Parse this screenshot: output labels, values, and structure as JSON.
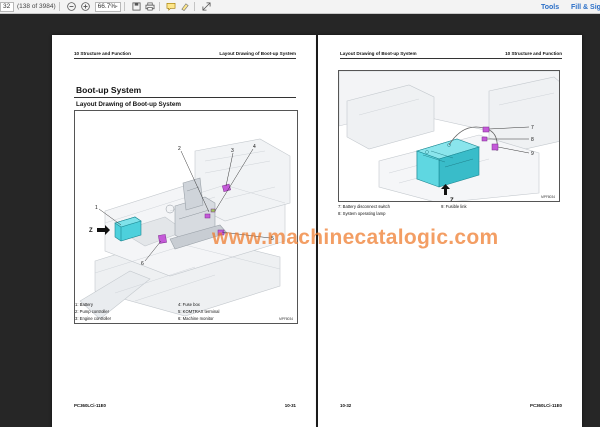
{
  "toolbar": {
    "page_input_value": "32",
    "page_count_text": "(138 of 3984)",
    "zoom_value": "66.7%",
    "tools_label": "Tools",
    "fill_sign_label": "Fill & Sign"
  },
  "page_left": {
    "header_left": "10 Structure and Function",
    "header_right": "Layout Drawing of Boot-up System",
    "section_title": "Boot-up System",
    "subsection_title": "Layout Drawing of Boot-up System",
    "figure_id": "MPF8034",
    "callouts": [
      "1",
      "2",
      "3",
      "4",
      "5",
      "6"
    ],
    "view_label": "Z",
    "legend": [
      "1: Battery",
      "4: Fuse box",
      "2: Pump controller",
      "5: KOMTRAX terminal",
      "3: Engine controller",
      "6: Machine monitor"
    ],
    "footer_left": "PC360LCi-11E0",
    "footer_right": "10-31"
  },
  "page_right": {
    "header_left": "Layout Drawing of Boot-up System",
    "header_right": "10 Structure and Function",
    "figure_id": "MPF8034",
    "callouts": [
      "7",
      "8",
      "9"
    ],
    "view_label": "Z",
    "legend": [
      "7: Battery disconnect switch",
      "9: Fusible link",
      "8: System operating lamp",
      ""
    ],
    "footer_left": "10-32",
    "footer_right": "PC360LCi-11E0"
  },
  "watermark": "www.machinecatalogic.com",
  "colors": {
    "battery": "#4dd0dc",
    "component_highlight": "#c45ad8",
    "watermark": "#ee7828",
    "page_bg": "#ffffff",
    "workspace_bg": "#262626"
  }
}
